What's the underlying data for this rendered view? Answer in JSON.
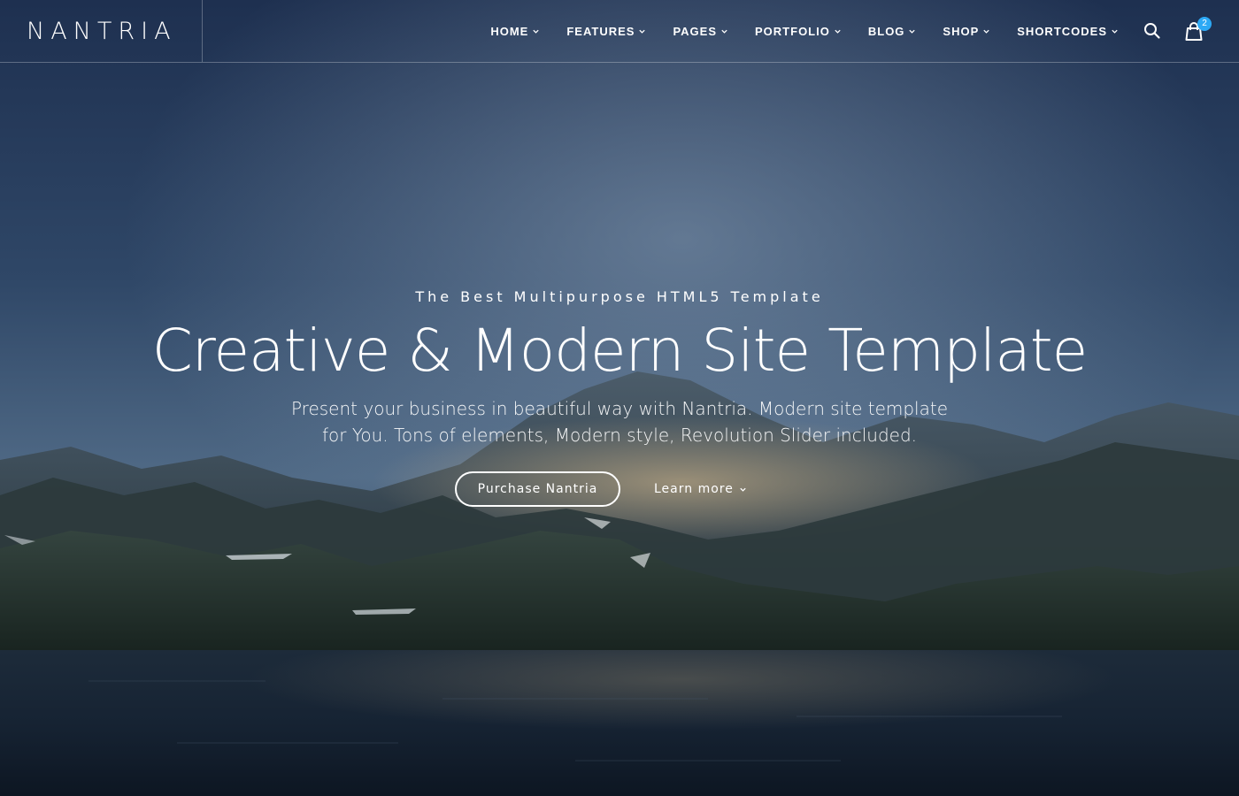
{
  "brand": {
    "logo": "NANTRIA"
  },
  "nav": {
    "items": [
      {
        "label": "HOME"
      },
      {
        "label": "FEATURES"
      },
      {
        "label": "PAGES"
      },
      {
        "label": "PORTFOLIO"
      },
      {
        "label": "BLOG"
      },
      {
        "label": "SHOP"
      },
      {
        "label": "SHORTCODES"
      }
    ],
    "search_icon": "search-icon",
    "cart_icon": "shopping-bag-icon",
    "cart_count": "2"
  },
  "hero": {
    "eyebrow": "The Best Multipurpose HTML5 Template",
    "title": "Creative & Modern Site Template",
    "description": "Present your business in beautiful way with Nantria. Modern site template for You. Tons of elements, Modern style, Revolution Slider included.",
    "primary_button": "Purchase Nantria",
    "secondary_button": "Learn more",
    "background": "mountain lake landscape at dusk"
  },
  "colors": {
    "badge": "#2da9f5",
    "text": "#ffffff",
    "sky_top": "#1f3150",
    "sky_mid": "#3c5576",
    "water": "#0f1d2e"
  }
}
